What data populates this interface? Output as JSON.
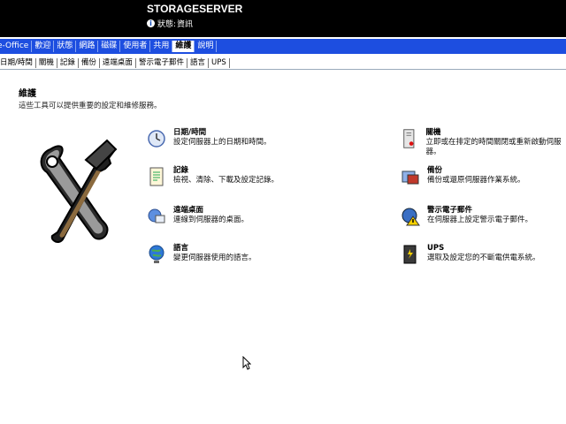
{
  "header": {
    "server_name": "STORAGESERVER",
    "status_label": "狀態:",
    "status_value": "資訊"
  },
  "main_nav": {
    "tabs": [
      {
        "label": "e-Office"
      },
      {
        "label": "歡迎"
      },
      {
        "label": "狀態"
      },
      {
        "label": "網路"
      },
      {
        "label": "磁碟"
      },
      {
        "label": "使用者"
      },
      {
        "label": "共用"
      },
      {
        "label": "維護",
        "active": true
      },
      {
        "label": "說明"
      }
    ]
  },
  "sub_nav": {
    "tabs": [
      {
        "label": "日期/時間"
      },
      {
        "label": "關機"
      },
      {
        "label": "記錄"
      },
      {
        "label": "備份"
      },
      {
        "label": "遠端桌面"
      },
      {
        "label": "警示電子郵件"
      },
      {
        "label": "語言"
      },
      {
        "label": "UPS"
      }
    ]
  },
  "page": {
    "title": "維護",
    "description": "這些工具可以提供重要的設定和維修服務。"
  },
  "tasks": [
    {
      "name": "日期/時間",
      "desc": "設定伺服器上的日期和時間。",
      "icon": "clock-icon"
    },
    {
      "name": "記錄",
      "desc": "檢視、清除、下載及設定記錄。",
      "icon": "log-icon"
    },
    {
      "name": "遠端桌面",
      "desc": "連線到伺服器的桌面。",
      "icon": "remote-desktop-icon"
    },
    {
      "name": "語言",
      "desc": "變更伺服器使用的語言。",
      "icon": "globe-icon"
    },
    {
      "name": "關機",
      "desc": "立即或在排定的時間關閉或重新啟動伺服器。",
      "icon": "shutdown-icon"
    },
    {
      "name": "備份",
      "desc": "備份或還原伺服器作業系統。",
      "icon": "backup-icon"
    },
    {
      "name": "警示電子郵件",
      "desc": "在伺服器上設定警示電子郵件。",
      "icon": "alert-email-icon"
    },
    {
      "name": "UPS",
      "desc": "選取及設定您的不斷電供電系統。",
      "icon": "ups-icon"
    }
  ],
  "colors": {
    "topbar": "#000000",
    "nav": "#1d4ee0"
  }
}
